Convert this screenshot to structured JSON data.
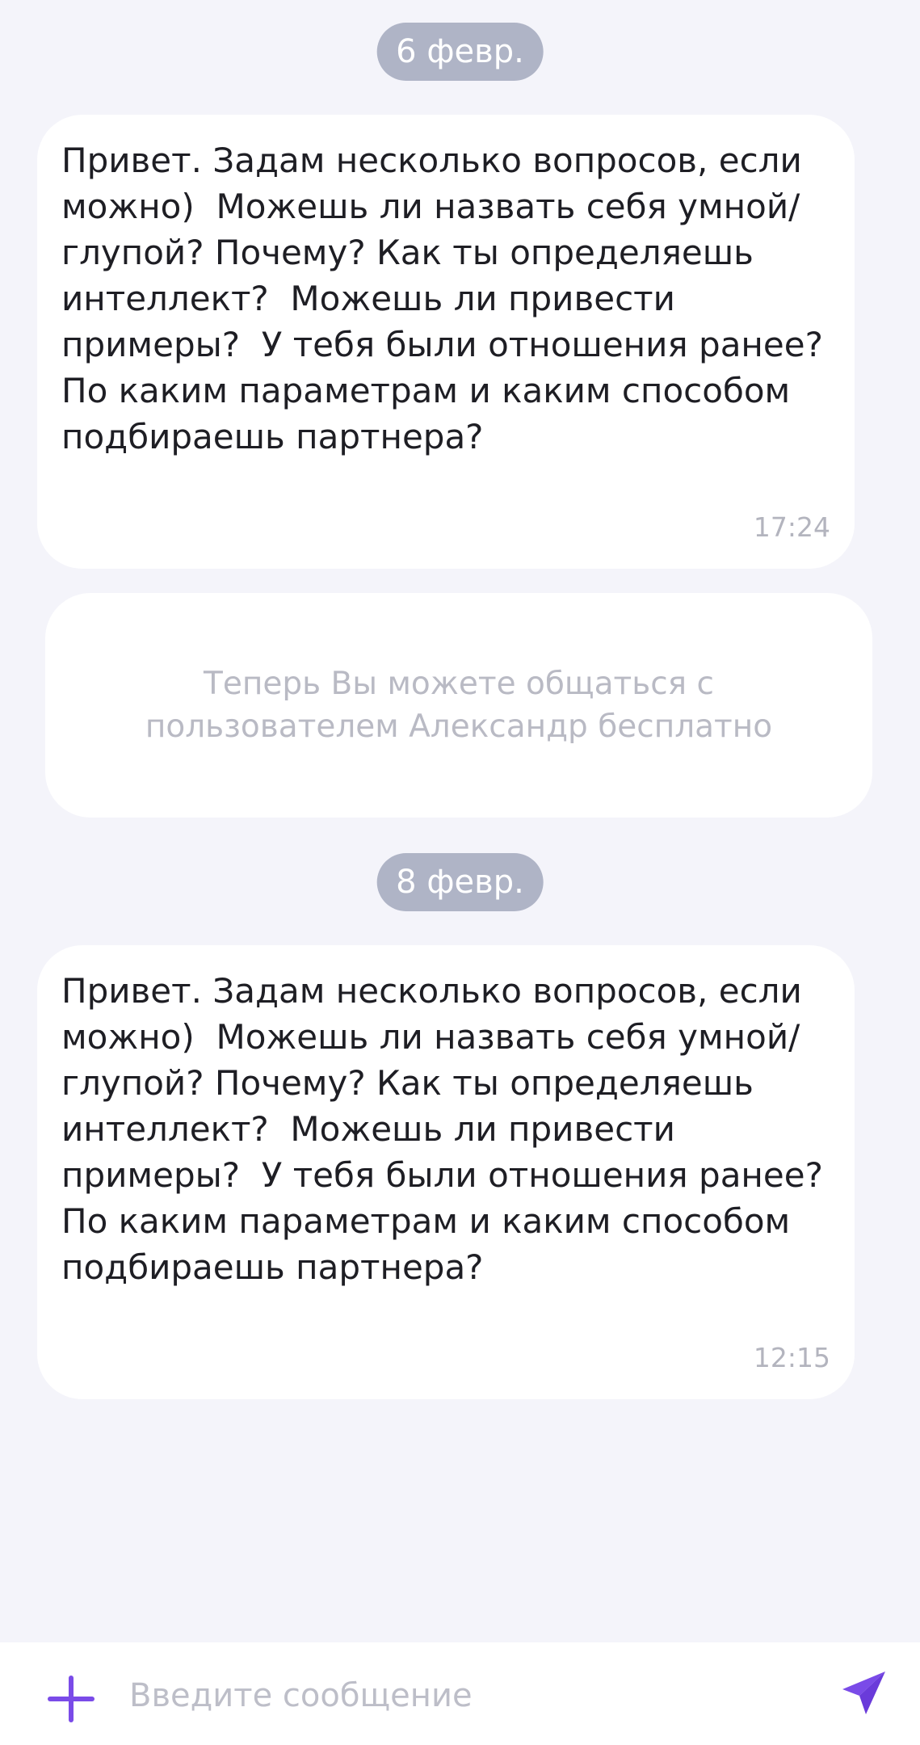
{
  "colors": {
    "background": "#F4F4FA",
    "bubble": "#FFFFFF",
    "date_pill": "#AFB4C6",
    "accent": "#7A4BE8",
    "muted_text": "#B9BAC4"
  },
  "dates": [
    {
      "label": "6 февр."
    },
    {
      "label": "8 февр."
    }
  ],
  "messages": [
    {
      "text": "Привет. Задам несколько вопросов, если можно)  Можешь ли назвать себя умной/глупой? Почему? Как ты определяешь интеллект?  Можешь ли привести примеры?  У тебя были отношения ранее? По каким параметрам и каким способом подбираешь партнера?",
      "time": "17:24"
    },
    {
      "text": "Привет. Задам несколько вопросов, если можно)  Можешь ли назвать себя умной/глупой? Почему? Как ты определяешь интеллект?  Можешь ли привести примеры?  У тебя были отношения ранее? По каким параметрам и каким способом подбираешь партнера?",
      "time": "12:15"
    }
  ],
  "system_notice": {
    "text": "Теперь Вы можете общаться с пользователем Александр бесплатно"
  },
  "composer": {
    "placeholder": "Введите сообщение",
    "value": "",
    "add_icon": "plus-icon",
    "send_icon": "send-icon"
  }
}
